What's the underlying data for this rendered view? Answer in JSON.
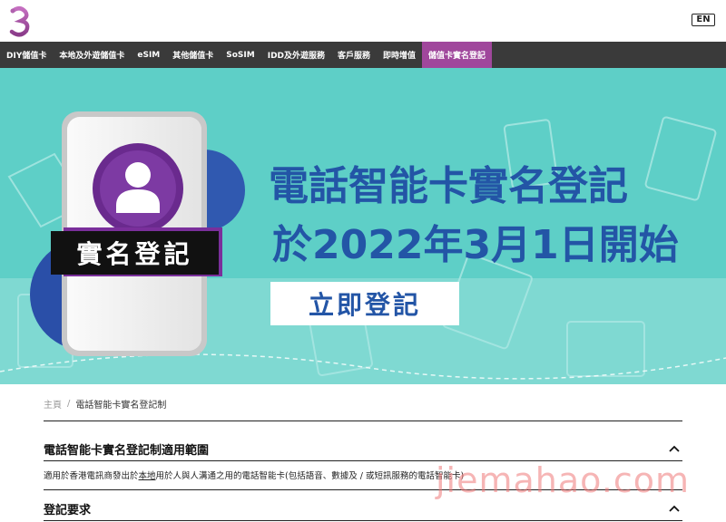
{
  "header": {
    "logo_icon": "three-logo-icon",
    "lang_button": "EN"
  },
  "nav": {
    "items": [
      {
        "label": "DIY儲值卡"
      },
      {
        "label": "本地及外遊儲值卡"
      },
      {
        "label": "eSIM"
      },
      {
        "label": "其他儲值卡"
      },
      {
        "label": "SoSIM"
      },
      {
        "label": "IDD及外遊服務"
      },
      {
        "label": "客戶服務"
      },
      {
        "label": "即時增值"
      },
      {
        "label": "儲值卡實名登記"
      }
    ],
    "active_color": "#a0479c"
  },
  "banner": {
    "badge_text": "實名登記",
    "headline_line1": "電話智能卡實名登記",
    "headline_line2": "於2022年3月1日開始",
    "cta_button": "立即登記",
    "bg_color": "#5ecfc7",
    "headline_color": "#2355a6",
    "person_icon": "person-avatar-icon"
  },
  "breadcrumb": {
    "home": "主頁",
    "separator": "/",
    "current": "電話智能卡實名登記制"
  },
  "sections": [
    {
      "title": "電話智能卡實名登記制適用範圍",
      "body_prefix": "適用於香港電訊商發出於",
      "body_link": "本地",
      "body_suffix": "用於人與人溝通之用的電話智能卡(包括語音、數據及 / 或短訊服務的電話智能卡)"
    },
    {
      "title": "登記要求"
    }
  ],
  "watermark": "jiemahao.com"
}
